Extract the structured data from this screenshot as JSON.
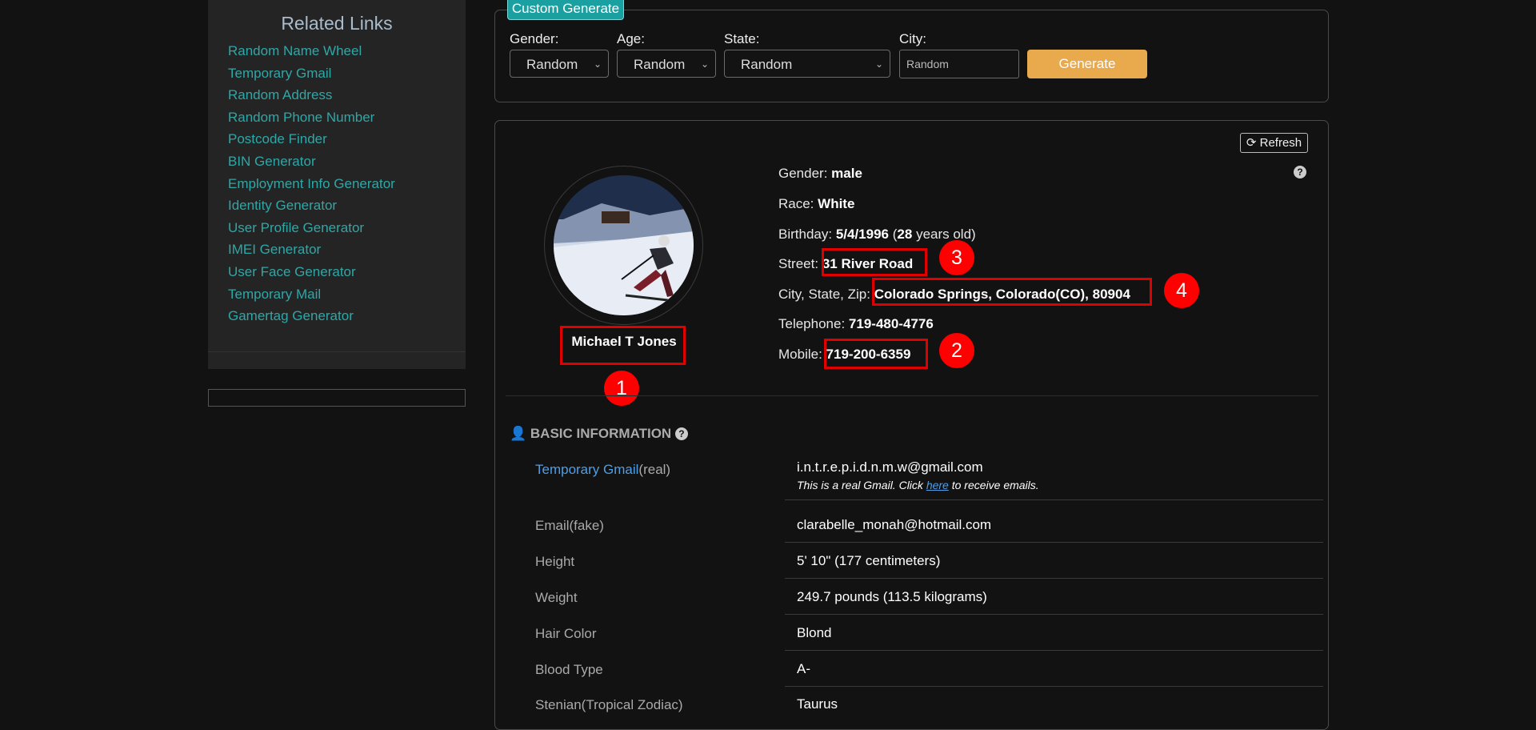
{
  "sidebar": {
    "title": "Related Links",
    "links": [
      "Random Name Wheel",
      "Temporary Gmail",
      "Random Address",
      "Random Phone Number",
      "Postcode Finder",
      "BIN Generator",
      "Employment Info Generator",
      "Identity Generator",
      "User Profile Generator",
      "IMEI Generator",
      "User Face Generator",
      "Temporary Mail",
      "Gamertag Generator"
    ]
  },
  "generator": {
    "tab": "Custom Generate",
    "gender_label": "Gender:",
    "gender_value": "Random",
    "age_label": "Age:",
    "age_value": "Random",
    "state_label": "State:",
    "state_value": "Random",
    "city_label": "City:",
    "city_placeholder": "Random",
    "button": "Generate"
  },
  "profile": {
    "refresh": "Refresh",
    "name": "Michael T Jones",
    "gender_label": "Gender:",
    "gender": "male",
    "race_label": "Race:",
    "race": "White",
    "birthday_label": "Birthday:",
    "birthday": "5/4/1996",
    "age": "28",
    "age_suffix": "years old)",
    "street_label": "Street:",
    "street": "31 River Road",
    "city_label": "City, State, Zip:",
    "city": "Colorado Springs, Colorado(CO), 80904",
    "telephone_label": "Telephone:",
    "telephone": "719-480-4776",
    "mobile_label": "Mobile:",
    "mobile": "719-200-6359"
  },
  "badges": [
    "1",
    "2",
    "3",
    "4"
  ],
  "basic": {
    "title": "BASIC INFORMATION",
    "gmail_link": "Temporary Gmail",
    "gmail_suffix": "(real)",
    "gmail_value": "i.n.t.r.e.p.i.d.n.m.w@gmail.com",
    "gmail_note_pre": "This is a real Gmail. Click ",
    "gmail_note_link": "here",
    "gmail_note_post": " to receive emails.",
    "rows": [
      {
        "label": "Email(fake)",
        "value": "clarabelle_monah@hotmail.com"
      },
      {
        "label": "Height",
        "value": "5' 10\" (177 centimeters)"
      },
      {
        "label": "Weight",
        "value": "249.7 pounds (113.5 kilograms)"
      },
      {
        "label": "Hair Color",
        "value": "Blond"
      },
      {
        "label": "Blood Type",
        "value": "A-"
      },
      {
        "label": "Stenian(Tropical Zodiac)",
        "value": "Taurus"
      }
    ]
  }
}
